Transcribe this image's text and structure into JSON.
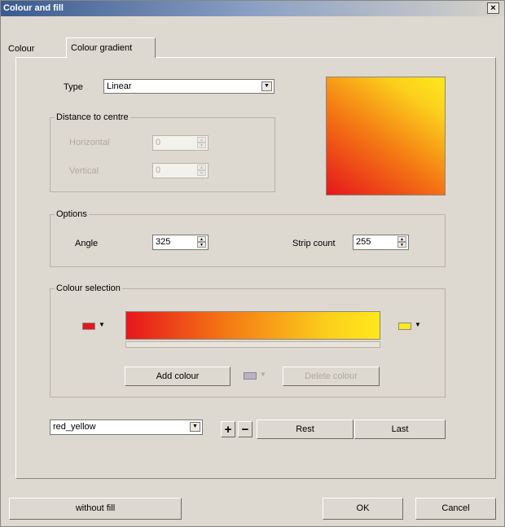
{
  "window": {
    "title": "Colour and fill",
    "close_glyph": "×"
  },
  "tabs": [
    {
      "label": "Colour",
      "active": false
    },
    {
      "label": "Colour gradient",
      "active": true
    }
  ],
  "type_field": {
    "label": "Type",
    "value": "Linear"
  },
  "distance_group": {
    "title": "Distance to centre",
    "horizontal_label": "Horizontal",
    "horizontal_value": "0",
    "vertical_label": "Vertical",
    "vertical_value": "0",
    "enabled": false
  },
  "options_group": {
    "title": "Options",
    "angle_label": "Angle",
    "angle_value": "325",
    "strip_count_label": "Strip count",
    "strip_count_value": "255"
  },
  "colour_selection": {
    "title": "Colour selection",
    "start_colour": "#e6161c",
    "end_colour": "#ffe81c",
    "middle_swatch_colour": "#b8b2c8",
    "add_colour_label": "Add colour",
    "delete_colour_label": "Delete colour",
    "dropdown_glyph": "▼"
  },
  "preset": {
    "value": "red_yellow",
    "add_glyph": "+",
    "remove_glyph": "−",
    "rest_label": "Rest",
    "last_label": "Last"
  },
  "footer": {
    "without_fill_label": "without fill",
    "ok_label": "OK",
    "cancel_label": "Cancel"
  },
  "spin": {
    "up_glyph": "▲",
    "down_glyph": "▼"
  }
}
